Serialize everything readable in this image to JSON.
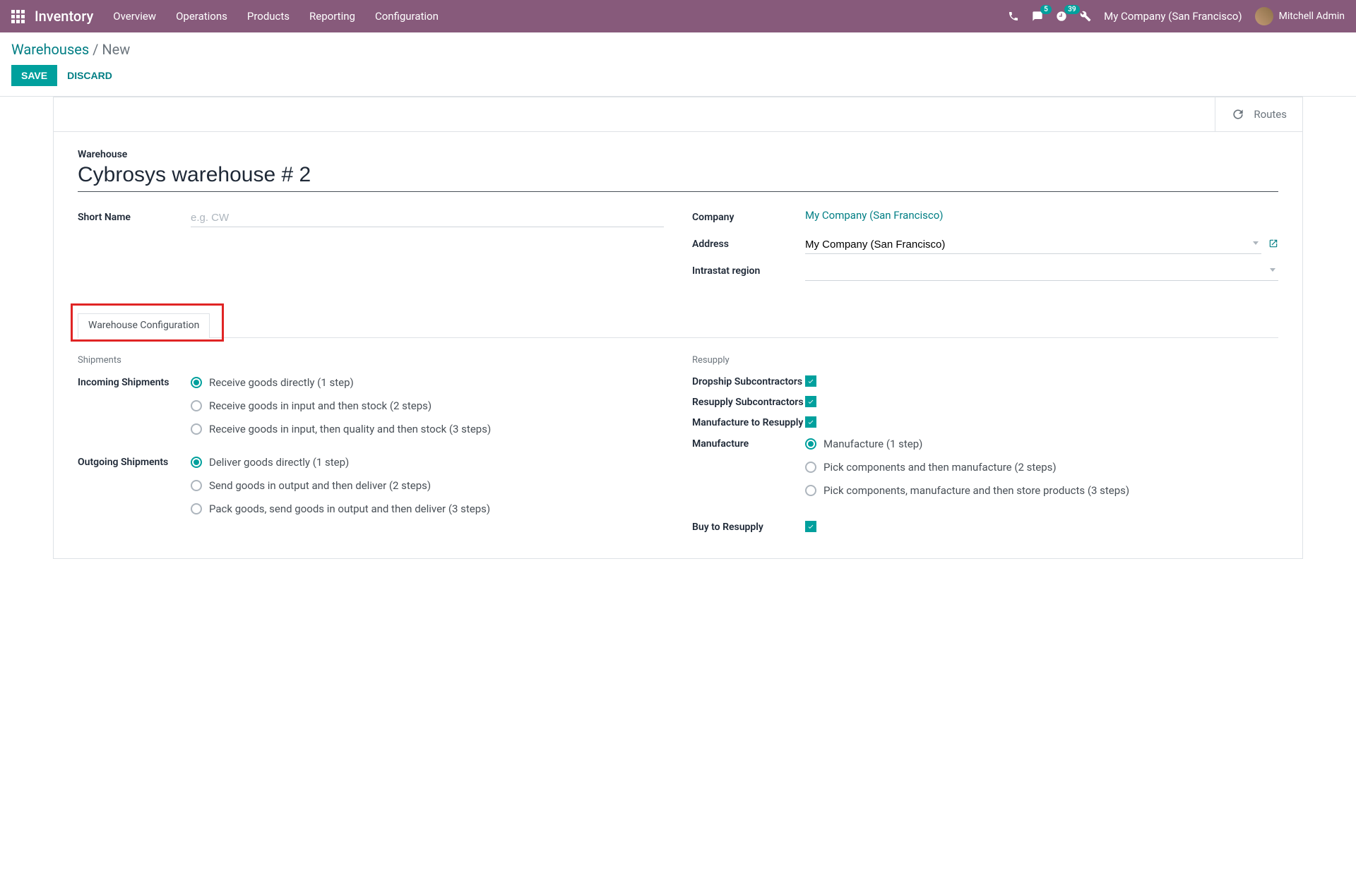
{
  "topnav": {
    "brand": "Inventory",
    "links": [
      "Overview",
      "Operations",
      "Products",
      "Reporting",
      "Configuration"
    ],
    "messages_badge": "5",
    "activities_badge": "39",
    "company": "My Company (San Francisco)",
    "user": "Mitchell Admin"
  },
  "breadcrumb": {
    "parent": "Warehouses",
    "current": "New"
  },
  "buttons": {
    "save": "SAVE",
    "discard": "DISCARD"
  },
  "stat": {
    "routes": "Routes"
  },
  "form": {
    "warehouse_label": "Warehouse",
    "warehouse_name": "Cybrosys warehouse # 2",
    "short_name_label": "Short Name",
    "short_name_placeholder": "e.g. CW",
    "short_name_value": "",
    "company_label": "Company",
    "company_value": "My Company (San Francisco)",
    "address_label": "Address",
    "address_value": "My Company (San Francisco)",
    "intrastat_label": "Intrastat region",
    "intrastat_value": ""
  },
  "tab": {
    "label": "Warehouse Configuration"
  },
  "shipments": {
    "section": "Shipments",
    "incoming_label": "Incoming Shipments",
    "incoming_options": [
      "Receive goods directly (1 step)",
      "Receive goods in input and then stock (2 steps)",
      "Receive goods in input, then quality and then stock (3 steps)"
    ],
    "outgoing_label": "Outgoing Shipments",
    "outgoing_options": [
      "Deliver goods directly (1 step)",
      "Send goods in output and then deliver (2 steps)",
      "Pack goods, send goods in output and then deliver (3 steps)"
    ]
  },
  "resupply": {
    "section": "Resupply",
    "dropship_label": "Dropship Subcontractors",
    "resupply_sub_label": "Resupply Subcontractors",
    "manuf_resupply_label": "Manufacture to Resupply",
    "manufacture_label": "Manufacture",
    "manufacture_options": [
      "Manufacture (1 step)",
      "Pick components and then manufacture (2 steps)",
      "Pick components, manufacture and then store products (3 steps)"
    ],
    "buy_label": "Buy to Resupply"
  }
}
